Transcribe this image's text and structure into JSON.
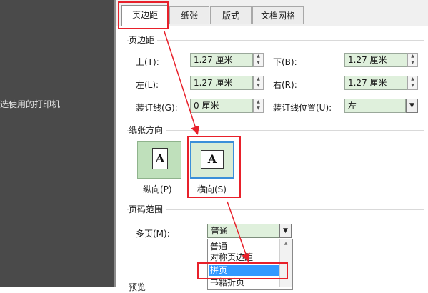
{
  "left_pane": {
    "text": "选使用的打印机"
  },
  "tabs": [
    {
      "label": "页边距",
      "active": true
    },
    {
      "label": "纸张",
      "active": false
    },
    {
      "label": "版式",
      "active": false
    },
    {
      "label": "文档网格",
      "active": false
    }
  ],
  "margins": {
    "section_title": "页边距",
    "top": {
      "label": "上(T):",
      "value": "1.27 厘米"
    },
    "bottom": {
      "label": "下(B):",
      "value": "1.27 厘米"
    },
    "left": {
      "label": "左(L):",
      "value": "1.27 厘米"
    },
    "right": {
      "label": "右(R):",
      "value": "1.27 厘米"
    },
    "gutter": {
      "label": "装订线(G):",
      "value": "0 厘米"
    },
    "gutter_pos": {
      "label": "装订线位置(U):",
      "value": "左"
    }
  },
  "orientation": {
    "section_title": "纸张方向",
    "portrait": {
      "label": "纵向(P)",
      "glyph": "A"
    },
    "landscape": {
      "label": "横向(S)",
      "glyph": "A",
      "selected": true
    }
  },
  "pages": {
    "section_title": "页码范围",
    "multiple_label": "多页(M):",
    "selected": "普通",
    "options": [
      "普通",
      "对称页边距",
      "拼页",
      "书籍折页"
    ],
    "highlighted": "拼页"
  },
  "bottom_cut_label": "预览",
  "colors": {
    "annotation": "#e8202a",
    "field_bg": "#dff0dc",
    "selection": "#3399ff"
  }
}
